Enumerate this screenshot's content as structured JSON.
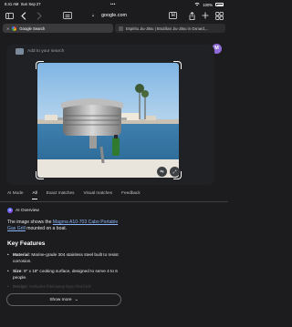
{
  "status_bar": {
    "time": "6:41 AM",
    "date": "Sun Sep 27",
    "dots": "•••",
    "battery": "100%"
  },
  "browser": {
    "url": "google.com",
    "tabs": [
      {
        "label": "Google Search",
        "active": true
      },
      {
        "label": "Espiritu Jiu-Jitsu | Brazilian Jiu-Jitsu in Oxnard,...",
        "active": false
      }
    ],
    "icons": [
      "sidebar-icon",
      "back-icon",
      "forward-icon",
      "text-size-icon",
      "bookmark-icon",
      "share-icon",
      "add-tab-icon",
      "tab-overview-icon"
    ]
  },
  "google": {
    "logo": "G",
    "avatar_initial": "M"
  },
  "lens": {
    "placeholder": "Add to your search",
    "close": "✕"
  },
  "filters": [
    "AI Mode",
    "All",
    "Exact matches",
    "Visual matches",
    "Feedback"
  ],
  "ai_overview": {
    "heading": "AI Overview",
    "text_before": "The image shows the ",
    "product_link": "Magma A10-703 Cabo Portable Gas Grill",
    "text_after": " mounted on a boat."
  },
  "key_features": {
    "title": "Key Features",
    "items": [
      {
        "label": "Material",
        "text": ": Marine-grade 304 stainless steel built to resist corrosion."
      },
      {
        "label": "Size",
        "text": ": 9\" x 18\" cooking surface, designed to serve 4 to 6 people."
      },
      {
        "label": "Design",
        "text": ": Includes fold-away legs that lock"
      }
    ]
  },
  "show_more": {
    "label": "Show more",
    "icon": "⌄"
  },
  "colors": {
    "background": "#1c1c1e",
    "panel": "#202124",
    "link": "#8ab4f8",
    "avatar": "#8e6bd6"
  }
}
